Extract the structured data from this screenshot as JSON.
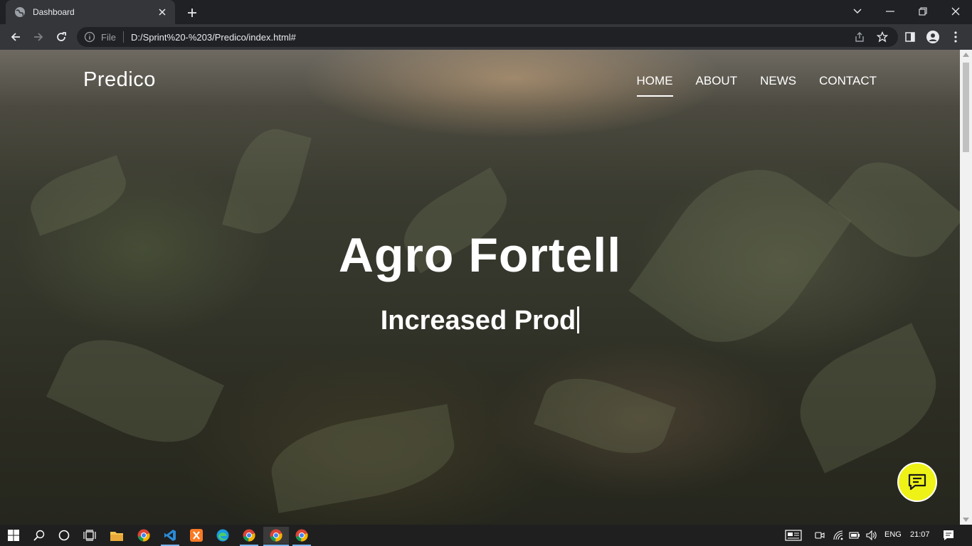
{
  "browser": {
    "tab_title": "Dashboard",
    "address_scheme": "File",
    "address_url": "D:/Sprint%20-%203/Predico/index.html#"
  },
  "page": {
    "brand": "Predico",
    "nav": [
      {
        "label": "HOME",
        "active": true
      },
      {
        "label": "ABOUT",
        "active": false
      },
      {
        "label": "NEWS",
        "active": false
      },
      {
        "label": "CONTACT",
        "active": false
      }
    ],
    "hero_title": "Agro Fortell",
    "hero_subtitle": "Increased Prod",
    "accent_color": "#eef217"
  },
  "taskbar": {
    "language": "ENG",
    "time": "21:07",
    "icons": [
      "windows-start-icon",
      "search-icon",
      "cortana-icon",
      "task-view-icon",
      "file-explorer-icon",
      "chrome-icon",
      "vscode-icon",
      "xampp-icon",
      "edge-icon",
      "chrome-icon",
      "chrome-icon",
      "chrome-icon"
    ]
  }
}
